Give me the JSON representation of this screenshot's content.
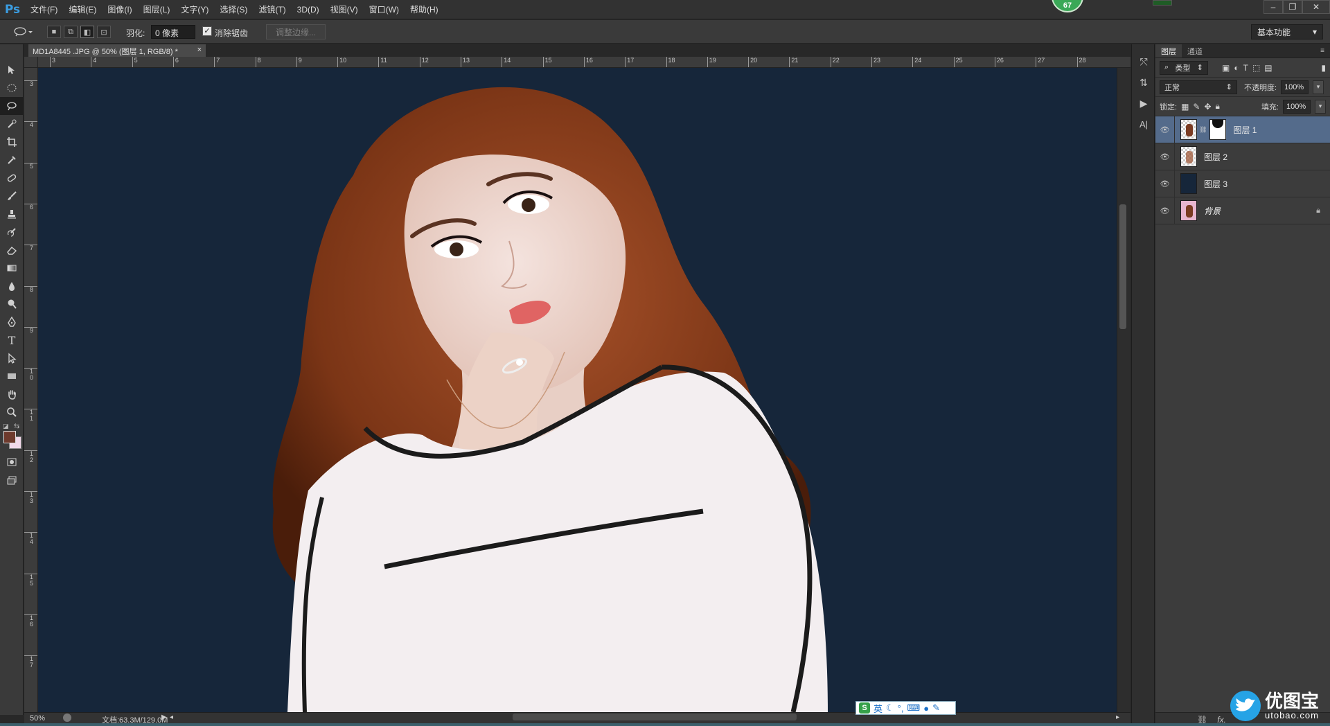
{
  "app": {
    "logo": "Ps"
  },
  "menu": [
    "文件(F)",
    "编辑(E)",
    "图像(I)",
    "图层(L)",
    "文字(Y)",
    "选择(S)",
    "滤镜(T)",
    "3D(D)",
    "视图(V)",
    "窗口(W)",
    "帮助(H)"
  ],
  "badge": "67",
  "options": {
    "feather_label": "羽化:",
    "feather_value": "0 像素",
    "antialias_label": "消除锯齿",
    "refine_edge": "调整边缘...",
    "workspace": "基本功能"
  },
  "document": {
    "tab_title": "MD1A8445 .JPG @ 50% (图层 1, RGB/8) *",
    "ruler_h": [
      "3",
      "4",
      "5",
      "6",
      "7",
      "8",
      "9",
      "10",
      "11",
      "12",
      "13",
      "14",
      "15",
      "16",
      "17",
      "18",
      "19",
      "20",
      "21",
      "22",
      "23",
      "24",
      "25",
      "26",
      "27",
      "28"
    ],
    "ruler_v": [
      "3",
      "4",
      "5",
      "6",
      "7",
      "8",
      "9",
      "10",
      "11",
      "12",
      "13",
      "14",
      "15",
      "16",
      "17"
    ],
    "zoom": "50%",
    "doc_info": "文档:63.3M/129.0M"
  },
  "ime": {
    "logo": "S",
    "mode": "英"
  },
  "layers_panel": {
    "tabs": [
      "图层",
      "通道"
    ],
    "filter_kind": "类型",
    "blend_mode": "正常",
    "opacity_label": "不透明度:",
    "opacity_value": "100%",
    "lock_label": "锁定:",
    "fill_label": "填充:",
    "fill_value": "100%",
    "layers": [
      {
        "name": "图层 1",
        "selected": true,
        "has_mask": true
      },
      {
        "name": "图层 2",
        "selected": false
      },
      {
        "name": "图层 3",
        "selected": false
      },
      {
        "name": "背景",
        "selected": false,
        "locked": true
      }
    ],
    "footer": "fx."
  },
  "watermark": {
    "title": "优图宝",
    "url": "utobao.com"
  },
  "colors": {
    "canvas_bg": "#16263a",
    "hair": "#8a3d1a",
    "selected_layer": "#546b8b"
  }
}
